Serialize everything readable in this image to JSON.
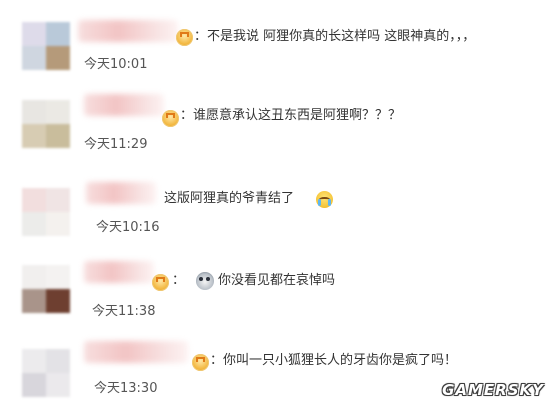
{
  "comments": [
    {
      "text": "：不是我说 阿狸你真的长这样吗 这眼神真的，，，",
      "time": "今天10:01",
      "emoji": ""
    },
    {
      "text": "：谁愿意承认这丑东西是阿狸啊？？？",
      "time": "今天11:29",
      "emoji": ""
    },
    {
      "text": "这版阿狸真的爷青结了",
      "time": "今天10:16",
      "emoji": "crying-emoji"
    },
    {
      "text": "你没看见都在哀悼吗",
      "time": "今天11:38",
      "emoji": "owl-emoji"
    },
    {
      "text": "：你叫一只小狐狸长人的牙齿你是疯了吗！",
      "time": "今天13:30",
      "emoji": ""
    }
  ],
  "watermark": "GAMERSKY"
}
